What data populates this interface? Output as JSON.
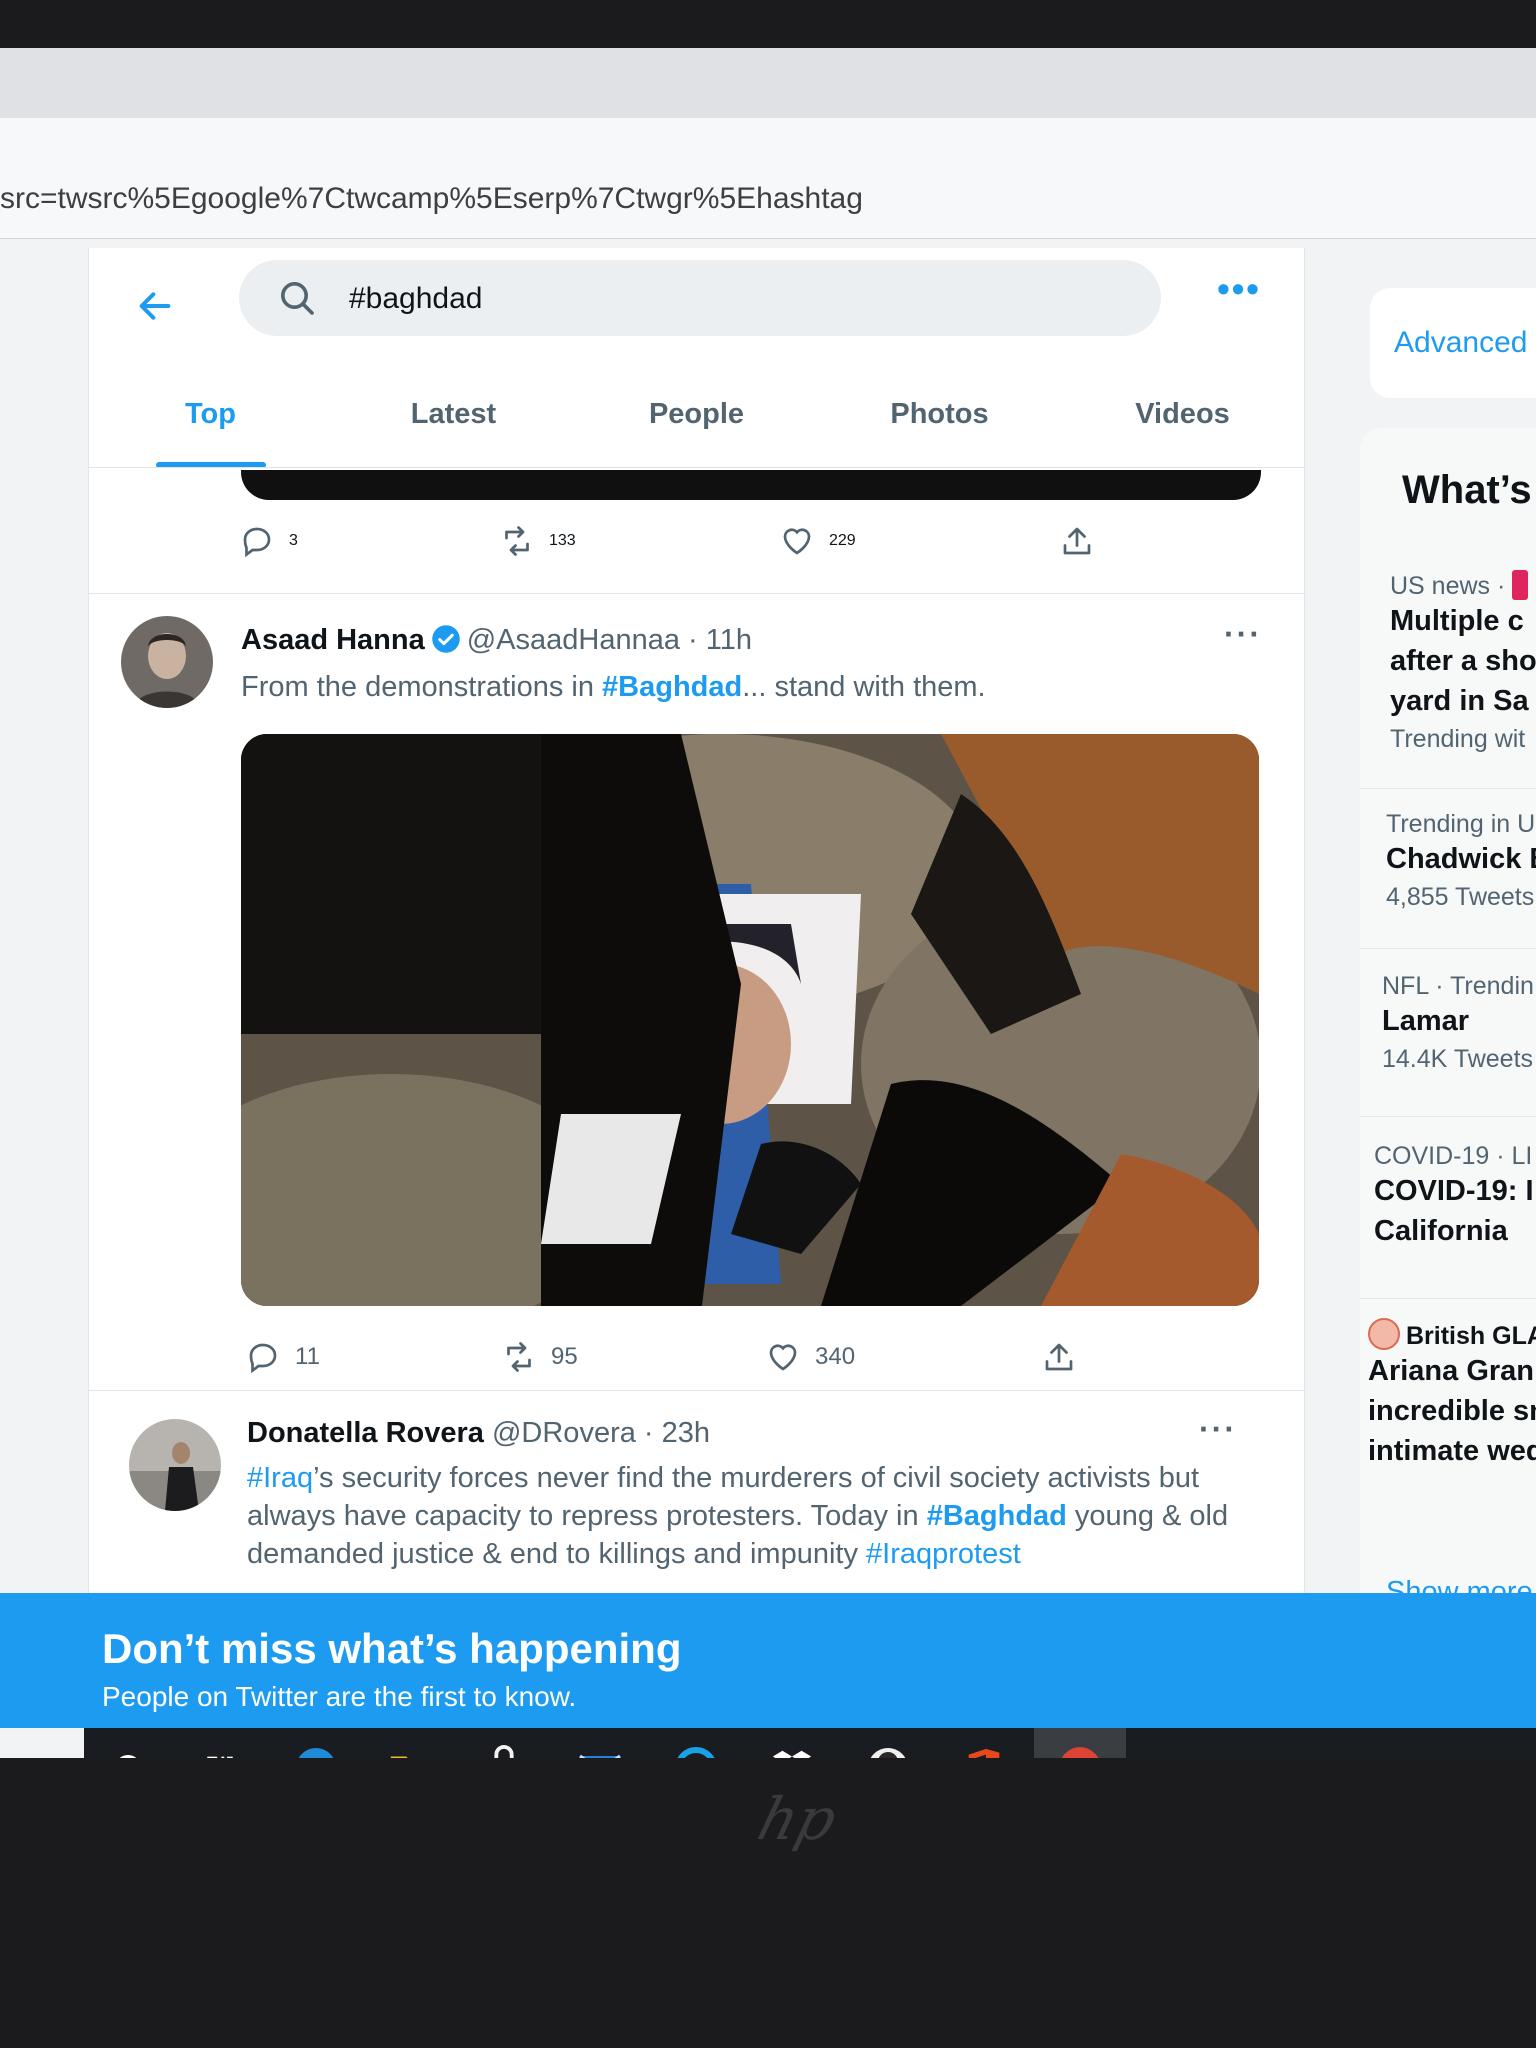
{
  "browser": {
    "url": "src=twsrc%5Egoogle%7Ctwcamp%5Eserp%7Ctwgr%5Ehashtag"
  },
  "search": {
    "value": "#baghdad"
  },
  "tabs": [
    {
      "label": "Top",
      "active": true
    },
    {
      "label": "Latest"
    },
    {
      "label": "People"
    },
    {
      "label": "Photos"
    },
    {
      "label": "Videos"
    }
  ],
  "previous_tweet": {
    "replies": "3",
    "retweets": "133",
    "likes": "229"
  },
  "tweets": [
    {
      "name": "Asaad Hanna",
      "handle": "@AsaadHannaa",
      "time": "11h",
      "text_before": "From the demonstrations in ",
      "hashtag": "#Baghdad",
      "text_after": "... stand with them.",
      "replies": "11",
      "retweets": "95",
      "likes": "340"
    },
    {
      "name": "Donatella Rovera",
      "handle": "@DRovera",
      "time": "23h",
      "tag1": "#Iraq",
      "text1": "’s security forces never find the murderers of civil society activists but always have capacity to repress protesters. Today in ",
      "tag2": "#Baghdad",
      "text2": " young & old demanded justice & end to killings and impunity ",
      "tag3": "#Iraqprotest"
    }
  ],
  "sidebar": {
    "advanced": "Advanced",
    "trends_title": "What’s",
    "trends": [
      {
        "meta": "US news ·",
        "title_lines": [
          "Multiple c",
          "after a sho",
          "yard in Sa"
        ],
        "count": "Trending wit"
      },
      {
        "meta": "Trending in U",
        "title_lines": [
          "Chadwick B"
        ],
        "count": "4,855 Tweets"
      },
      {
        "meta": "NFL · Trendin",
        "title_lines": [
          "Lamar"
        ],
        "count": "14.4K Tweets"
      },
      {
        "meta": "COVID-19 · LI",
        "title_lines": [
          "COVID-19: I",
          "California"
        ],
        "count": ""
      },
      {
        "meta": "British GLA",
        "title_lines": [
          "Ariana Gran",
          "incredible sn",
          "intimate wed"
        ],
        "count": ""
      }
    ],
    "show_more": "Show more"
  },
  "banner": {
    "title": "Don’t miss what’s happening",
    "subtitle": "People on Twitter are the first to know."
  },
  "taskbar": {
    "apps": [
      "cortana-circle-icon",
      "task-view-icon",
      "edge-icon",
      "file-explorer-icon",
      "store-icon",
      "mail-icon",
      "cortana-icon",
      "dropbox-icon",
      "unknown-app-icon",
      "office-icon",
      "chrome-icon"
    ]
  },
  "colors": {
    "accent": "#1d9bf0",
    "banner": "#1d9bf0",
    "text_secondary": "#536471"
  }
}
